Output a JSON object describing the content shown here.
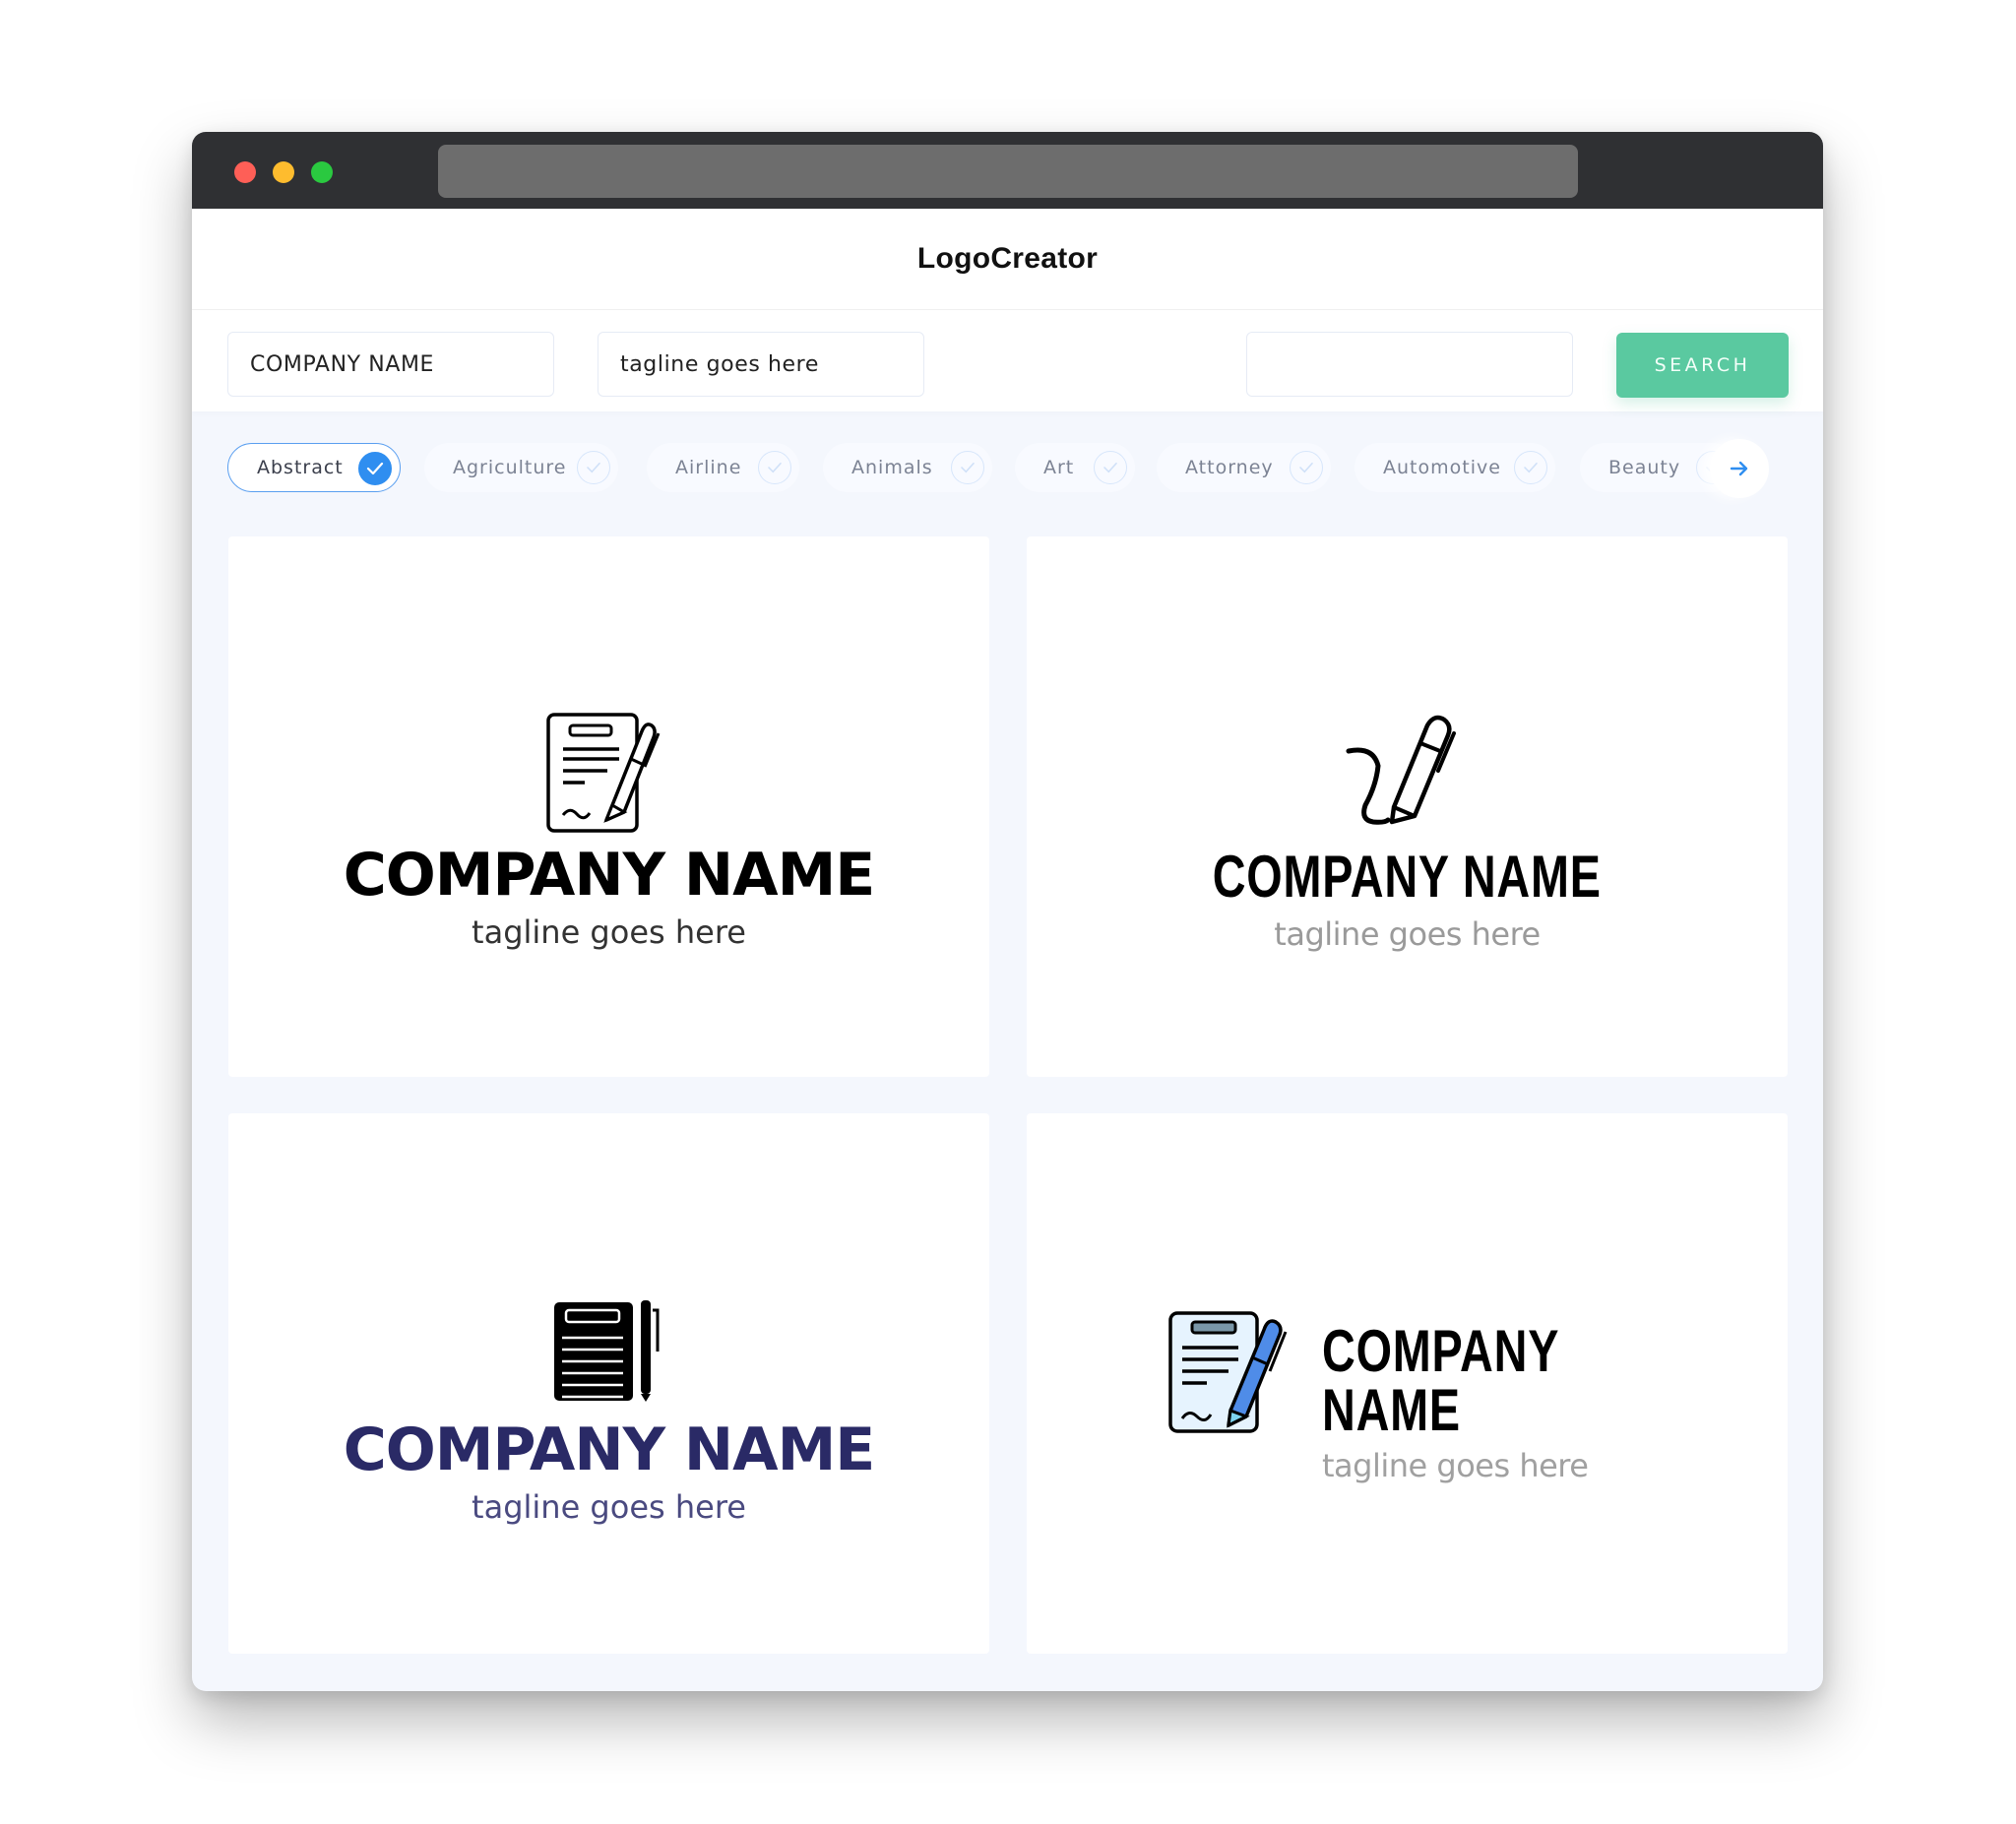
{
  "window": {
    "controls": [
      "close",
      "minimize",
      "maximize"
    ],
    "address_bar": ""
  },
  "app": {
    "title": "LogoCreator"
  },
  "search": {
    "company_name_value": "COMPANY NAME",
    "tagline_value": "tagline goes here",
    "extra_value": "",
    "search_button": "SEARCH",
    "accent_color": "#5ac9a0"
  },
  "categories": {
    "items": [
      {
        "label": "Abstract",
        "selected": true
      },
      {
        "label": "Agriculture",
        "selected": false
      },
      {
        "label": "Airline",
        "selected": false
      },
      {
        "label": "Animals",
        "selected": false
      },
      {
        "label": "Art",
        "selected": false
      },
      {
        "label": "Attorney",
        "selected": false
      },
      {
        "label": "Automotive",
        "selected": false
      },
      {
        "label": "Beauty",
        "selected": false
      }
    ],
    "next_icon": "arrow-right-icon",
    "active_color": "#2f8ef0"
  },
  "logos": [
    {
      "icon": "document-pen-outline-icon",
      "name": "COMPANY NAME",
      "tagline": "tagline goes here",
      "name_color": "#000000",
      "tagline_color": "#333333"
    },
    {
      "icon": "pen-signature-icon",
      "name": "COMPANY NAME",
      "tagline": "tagline goes here",
      "name_color": "#000000",
      "tagline_color": "#9a9a9a"
    },
    {
      "icon": "document-pen-solid-icon",
      "name": "COMPANY NAME",
      "tagline": "tagline goes here",
      "name_color": "#2a2a66",
      "tagline_color": "#4a4a80"
    },
    {
      "icon": "document-pen-color-icon",
      "name": "COMPANY NAME",
      "tagline": "tagline goes here",
      "name_color": "#000000",
      "tagline_color": "#a0a0a0"
    }
  ]
}
